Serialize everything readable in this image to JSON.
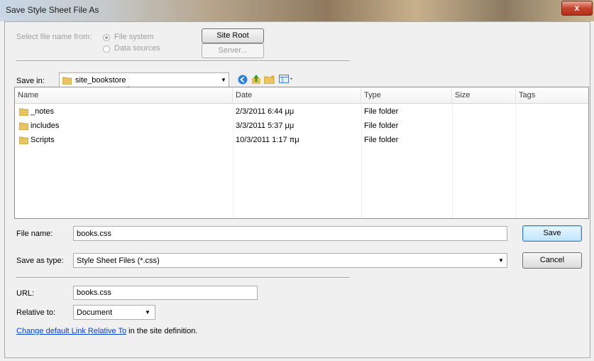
{
  "window": {
    "title": "Save Style Sheet File As",
    "close_glyph": "x"
  },
  "source": {
    "label": "Select file name from:",
    "options": [
      "File system",
      "Data sources"
    ],
    "selected": "File system",
    "site_root_button": "Site Root",
    "server_button": "Server..."
  },
  "save_in": {
    "label": "Save in:",
    "folder": "site_bookstore"
  },
  "file_list": {
    "columns": [
      "Name",
      "Date",
      "Type",
      "Size",
      "Tags"
    ],
    "rows": [
      {
        "name": "_notes",
        "date": "2/3/2011 6:44 μμ",
        "type": "File folder",
        "size": "",
        "tags": ""
      },
      {
        "name": "includes",
        "date": "3/3/2011 5:37 μμ",
        "type": "File folder",
        "size": "",
        "tags": ""
      },
      {
        "name": "Scripts",
        "date": "10/3/2011 1:17 πμ",
        "type": "File folder",
        "size": "",
        "tags": ""
      }
    ]
  },
  "file_name": {
    "label": "File name:",
    "value": "books.css"
  },
  "save_as_type": {
    "label": "Save as type:",
    "value": "Style Sheet Files (*.css)"
  },
  "buttons": {
    "save": "Save",
    "cancel": "Cancel"
  },
  "url": {
    "label": "URL:",
    "value": "books.css"
  },
  "relative_to": {
    "label": "Relative to:",
    "value": "Document"
  },
  "footer": {
    "link_text": "Change default Link Relative To",
    "suffix": " in the site definition."
  }
}
